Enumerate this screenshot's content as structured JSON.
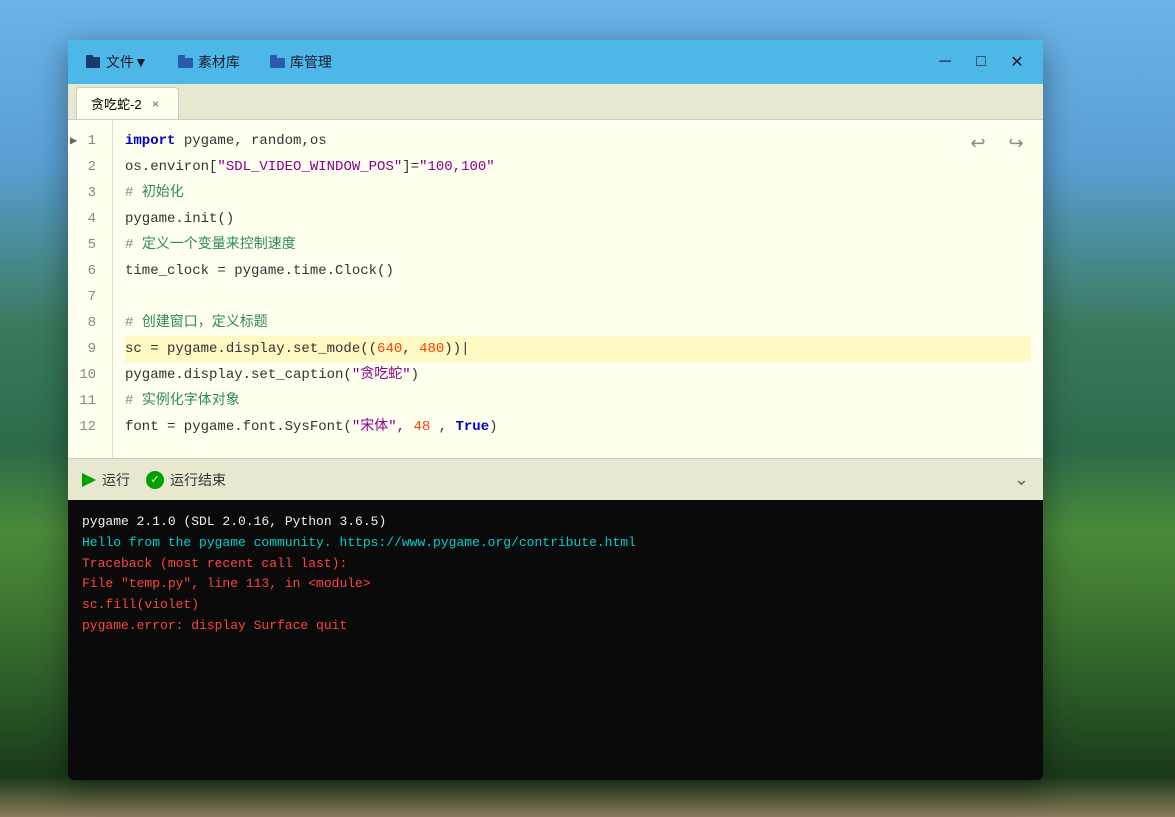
{
  "background": {
    "description": "landscape background"
  },
  "window": {
    "titlebar": {
      "menus": [
        {
          "label": "文件▼",
          "icon": "file-icon"
        },
        {
          "label": "素材库",
          "icon": "folder-icon"
        },
        {
          "label": "库管理",
          "icon": "library-icon"
        }
      ],
      "controls": {
        "minimize": "─",
        "maximize": "□",
        "close": "✕"
      }
    },
    "tab": {
      "label": "贪吃蛇-2",
      "close": "×"
    },
    "code_lines": [
      {
        "num": 1,
        "content": "import pygame, random,os",
        "active": false
      },
      {
        "num": 2,
        "content": "os.environ[\"SDL_VIDEO_WINDOW_POS\"]=\"100,100\"",
        "active": false
      },
      {
        "num": 3,
        "content": "# 初始化",
        "active": false
      },
      {
        "num": 4,
        "content": "pygame.init()",
        "active": false
      },
      {
        "num": 5,
        "content": "# 定义一个变量来控制速度",
        "active": false
      },
      {
        "num": 6,
        "content": "time_clock = pygame.time.Clock()",
        "active": false
      },
      {
        "num": 7,
        "content": "",
        "active": false
      },
      {
        "num": 8,
        "content": "# 创建窗口，定义标题",
        "active": false
      },
      {
        "num": 9,
        "content": "sc = pygame.display.set_mode((640, 480))|",
        "active": true
      },
      {
        "num": 10,
        "content": "pygame.display.set_caption(\"贪吃蛇\")",
        "active": false
      },
      {
        "num": 11,
        "content": "# 实例化字体对象",
        "active": false
      },
      {
        "num": 12,
        "content": "font = pygame.font.SysFont(\"宋体\", 48 , True)",
        "active": false
      }
    ],
    "toolbar": {
      "run_label": "运行",
      "run_complete_label": "运行结束"
    },
    "console": {
      "lines": [
        {
          "text": "pygame 2.1.0 (SDL 2.0.16, Python 3.6.5)",
          "color": "white"
        },
        {
          "text": "Hello from the pygame community. https://www.pygame.org/contribute.html",
          "color": "cyan"
        },
        {
          "text": "Traceback (most recent call last):",
          "color": "red"
        },
        {
          "text": "  File \"temp.py\", line 113, in <module>",
          "color": "red"
        },
        {
          "text": "    sc.fill(violet)",
          "color": "red"
        },
        {
          "text": "pygame.error: display Surface quit",
          "color": "red"
        }
      ]
    }
  }
}
